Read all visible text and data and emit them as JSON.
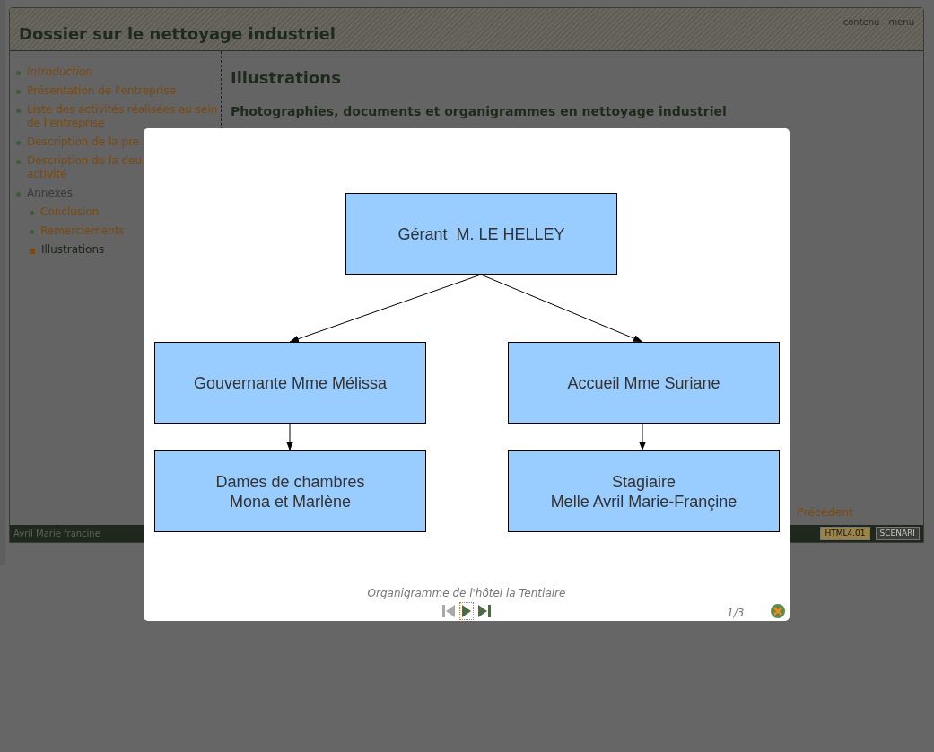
{
  "header": {
    "title": "Dossier sur le nettoyage industriel",
    "links": [
      "contenu",
      "menu"
    ]
  },
  "sidebar": {
    "items": [
      {
        "label": "Introduction",
        "kind": "link",
        "emphasized": true,
        "selected": false
      },
      {
        "label": "Présentation de l'entreprise",
        "kind": "link",
        "emphasized": false,
        "selected": false
      },
      {
        "label": "Liste des activités réalisées au sein",
        "label_2": "de l'entreprise",
        "kind": "link",
        "emphasized": false,
        "selected": false
      },
      {
        "label": "Description de la pre",
        "kind": "link",
        "emphasized": false,
        "selected": false
      },
      {
        "label": "Description de la deu",
        "label_2": "activité",
        "kind": "link",
        "emphasized": false,
        "selected": false
      },
      {
        "label": "Annexes",
        "kind": "group",
        "emphasized": false,
        "selected": false,
        "children": [
          {
            "label": "Conclusion",
            "kind": "link",
            "emphasized": false,
            "selected": false
          },
          {
            "label": "Remerciements",
            "kind": "link",
            "emphasized": false,
            "selected": false
          },
          {
            "label": "Illustrations",
            "kind": "link",
            "emphasized": false,
            "selected": true
          }
        ]
      }
    ]
  },
  "content": {
    "title": "Illustrations",
    "subtitle": "Photographies, documents et organigrammes en nettoyage industriel",
    "previous": "Précédent"
  },
  "footer": {
    "author": "Avril Marie francine",
    "badges": [
      {
        "label": "HTML4.01",
        "kind": "validator"
      },
      {
        "label": "SCENARI",
        "kind": "tool"
      }
    ]
  },
  "lightbox": {
    "chart": {
      "nodes": [
        {
          "lines": [
            "Gérant  M. LE HELLEY"
          ]
        },
        {
          "lines": [
            "Gouvernante Mme Mélissa"
          ]
        },
        {
          "lines": [
            "Accueil Mme Suriane"
          ]
        },
        {
          "lines": [
            "Dames de chambres",
            "Mona et Marlène"
          ]
        },
        {
          "lines": [
            "Stagiaire",
            "Melle Avril Marie-Françine"
          ]
        }
      ]
    },
    "caption": "Organigramme de l'hôtel la Tentiaire",
    "nav": [
      {
        "kind": "first",
        "disabled": true,
        "focused": false
      },
      {
        "kind": "play",
        "disabled": false,
        "focused": true
      },
      {
        "kind": "last",
        "disabled": false,
        "focused": false
      }
    ],
    "counter": "1/3"
  }
}
